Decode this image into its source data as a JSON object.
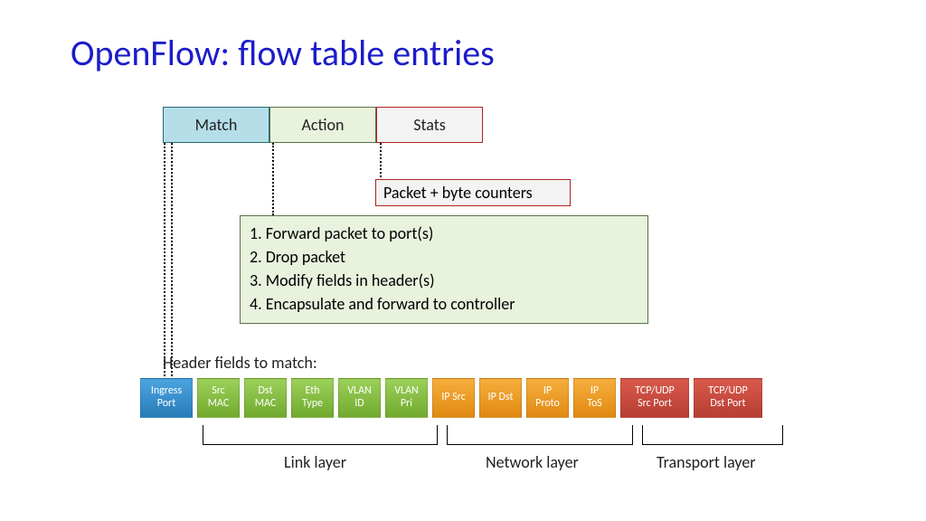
{
  "title": "OpenFlow: flow table entries",
  "top": {
    "match": "Match",
    "action": "Action",
    "stats": "Stats"
  },
  "stats_detail": "Packet + byte counters",
  "actions": {
    "a1": "1.  Forward packet to port(s)",
    "a2": "2.  Drop packet",
    "a3": "3.  Modify fields in header(s)",
    "a4": "4.  Encapsulate and forward to controller"
  },
  "match_label": "Header fields to match:",
  "headers": {
    "h0": "Ingress\nPort",
    "h1": "Src\nMAC",
    "h2": "Dst\nMAC",
    "h3": "Eth\nType",
    "h4": "VLAN\nID",
    "h5": "VLAN\nPri",
    "h6": "IP Src",
    "h7": "IP Dst",
    "h8": "IP\nProto",
    "h9": "IP\nToS",
    "h10": "TCP/UDP\nSrc Port",
    "h11": "TCP/UDP\nDst Port"
  },
  "layers": {
    "link": "Link layer",
    "net": "Network layer",
    "trans": "Transport layer"
  }
}
